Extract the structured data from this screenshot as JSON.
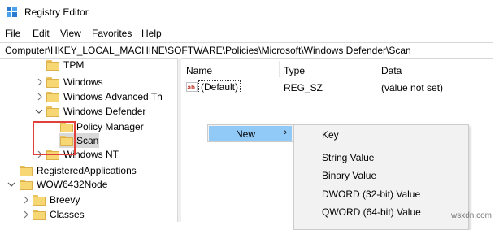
{
  "window": {
    "title": "Registry Editor"
  },
  "menubar": [
    "File",
    "Edit",
    "View",
    "Favorites",
    "Help"
  ],
  "address": "Computer\\HKEY_LOCAL_MACHINE\\SOFTWARE\\Policies\\Microsoft\\Windows Defender\\Scan",
  "tree": [
    {
      "label": "TPM",
      "chevron": ""
    },
    {
      "label": "Windows",
      "chevron": "right"
    },
    {
      "label": "Windows Advanced Th",
      "chevron": "right"
    },
    {
      "label": "Windows Defender",
      "chevron": "down"
    },
    {
      "label": "Policy Manager",
      "chevron": ""
    },
    {
      "label": "Scan",
      "chevron": "",
      "selected": true
    },
    {
      "label": "Windows NT",
      "chevron": "right"
    },
    {
      "label": "RegisteredApplications",
      "chevron": ""
    },
    {
      "label": "WOW6432Node",
      "chevron": "down"
    },
    {
      "label": "Breevy",
      "chevron": "right"
    },
    {
      "label": "Classes",
      "chevron": "right"
    }
  ],
  "list": {
    "columns": [
      "Name",
      "Type",
      "Data"
    ],
    "rows": [
      {
        "name": "(Default)",
        "type": "REG_SZ",
        "data": "(value not set)",
        "icon": "string-value-icon"
      }
    ]
  },
  "context_menu": {
    "new_label": "New",
    "arrow": "›"
  },
  "submenu": [
    "Key",
    "String Value",
    "Binary Value",
    "DWORD (32-bit) Value",
    "QWORD (64-bit) Value"
  ],
  "watermark": "wsxdn.com",
  "colors": {
    "highlight_border": "#e2403a",
    "menu_hover": "#91c9f7",
    "folder": "#f7d674"
  }
}
